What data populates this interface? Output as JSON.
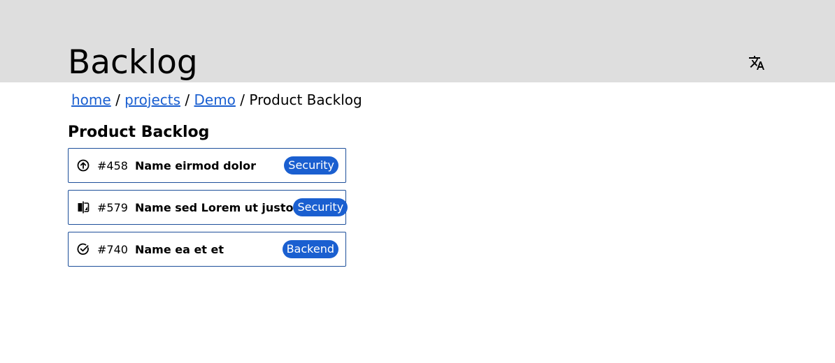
{
  "header": {
    "title": "Backlog",
    "language_icon": "translate-icon"
  },
  "breadcrumb": {
    "links": [
      "home",
      "projects",
      "Demo"
    ],
    "current": "Product Backlog",
    "separator": "/"
  },
  "section": {
    "title": "Product Backlog"
  },
  "items": [
    {
      "icon": "arrow-up-circle-icon",
      "number": "#458",
      "name": "Name eirmod dolor",
      "tag": "Security"
    },
    {
      "icon": "compare-icon",
      "number": "#579",
      "name": "Name sed Lorem ut justo",
      "tag": "Security"
    },
    {
      "icon": "check-circle-icon",
      "number": "#740",
      "name": "Name ea et et",
      "tag": "Backend"
    }
  ],
  "colors": {
    "header_bg": "#dedede",
    "link": "#1a5fd0",
    "tag_bg": "#1a5fd0",
    "item_border": "#1d4f9a"
  }
}
